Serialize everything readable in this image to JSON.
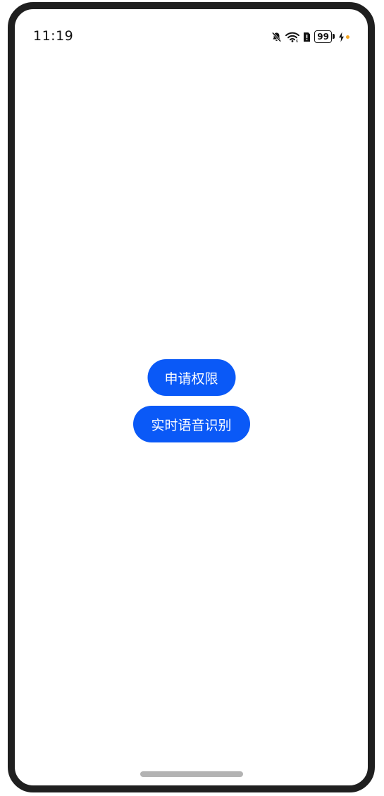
{
  "status_bar": {
    "time": "11:19",
    "battery_level": "99",
    "icons": [
      "bell-muted-icon",
      "wifi-icon",
      "sim-alert-icon",
      "battery-icon",
      "charging-icon"
    ],
    "charging_dot_color": "#f5a623"
  },
  "main": {
    "request_permission_label": "申请权限",
    "realtime_asr_label": "实时语音识别",
    "button_color": "#0a59f7"
  }
}
